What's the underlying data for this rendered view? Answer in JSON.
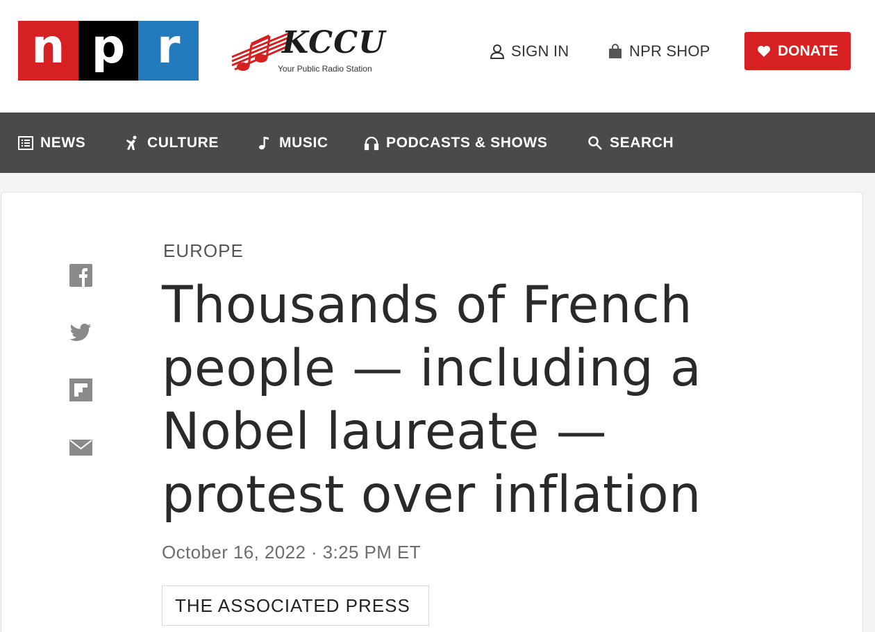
{
  "header": {
    "logo_letters": [
      "n",
      "p",
      "r"
    ],
    "station_name": "KCCU",
    "station_tagline": "Your Public Radio Station",
    "sign_in_label": "SIGN IN",
    "shop_label": "NPR SHOP",
    "donate_label": "DONATE"
  },
  "nav": {
    "items": [
      {
        "label": "NEWS",
        "icon": "news-icon"
      },
      {
        "label": "CULTURE",
        "icon": "culture-icon"
      },
      {
        "label": "MUSIC",
        "icon": "music-note-icon"
      },
      {
        "label": "PODCASTS & SHOWS",
        "icon": "headphones-icon"
      },
      {
        "label": "SEARCH",
        "icon": "search-icon"
      }
    ]
  },
  "share": {
    "icons": [
      "facebook-icon",
      "twitter-icon",
      "flipboard-icon",
      "email-icon"
    ]
  },
  "article": {
    "slug": "EUROPE",
    "headline": "Thousands of French people — including a Nobel laureate — protest over inflation",
    "dateline": "October 16, 2022 · 3:25 PM ET",
    "byline": "THE ASSOCIATED PRESS"
  },
  "colors": {
    "npr_red": "#d62021",
    "npr_black": "#000000",
    "npr_blue": "#237bbd",
    "nav_background": "#4a4a4a",
    "donate": "#d62021"
  }
}
